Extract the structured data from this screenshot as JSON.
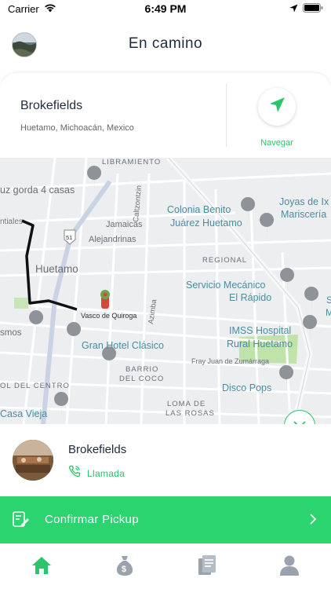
{
  "status_bar": {
    "carrier": "Carrier",
    "time": "6:49 PM"
  },
  "header": {
    "title": "En camino"
  },
  "destination": {
    "name": "Brokefields",
    "address": "Huetamo, Michoacán, Mexico",
    "navigate_label": "Navegar"
  },
  "map": {
    "labels": {
      "libramiento": "LIBRAMIENTO",
      "luz_gorda": "uz gorda 4 casas",
      "tiales": "ntiales",
      "jamaicas": "Jamaicas",
      "caltzontzin": "Caltzontzin",
      "colonia_benito": "Colonia Benito",
      "juarez_huetamo": "Juárez Huetamo",
      "joyas": "Joyas de Ix",
      "mariscos": "Mariscería",
      "alejandrinas": "Alejandrinas",
      "route_51": "51",
      "huetamo": "Huetamo",
      "regional": "REGIONAL",
      "servicio": "Servicio Mecánico",
      "el_rapido": "El Rápido",
      "vasco": "Vasco de Quiroga",
      "azimba": "Azimba",
      "smos": "smos",
      "imss_hospital": "IMSS Hospital",
      "rural_huetamo": "Rural Huetamo",
      "gran_hotel": "Gran Hotel Clásico",
      "fray_juan": "Fray Juan de Zumárraga",
      "barrio": "BARRIO",
      "del_coco": "DEL COCO",
      "ol_del_centro": "OL DEL CENTRO",
      "disco_pops": "Disco Pops",
      "loma": "LOMA DE",
      "las_rosas": "LAS ROSAS",
      "casa_vieja": "Casa Vieja",
      "s_label": "S",
      "m_label": "M"
    }
  },
  "customer": {
    "name": "Brokefields",
    "call_label": "Llamada"
  },
  "confirm": {
    "label": "Confirmar Pickup"
  },
  "colors": {
    "accent": "#2cd46f",
    "accent_text": "#2cc46c",
    "tab_active": "#2cc46c",
    "tab_inactive": "#9aa3ad"
  },
  "icons": {
    "wifi": "wifi-icon",
    "location_arrow": "location-arrow-icon",
    "battery": "battery-icon",
    "navigate": "navigation-arrow-icon",
    "chevron_down": "chevron-down-icon",
    "phone": "phone-icon",
    "edit": "edit-document-icon",
    "chevron_right": "chevron-right-icon",
    "home": "home-icon",
    "money_bag": "money-bag-icon",
    "receipts": "receipts-icon",
    "profile": "profile-icon"
  }
}
